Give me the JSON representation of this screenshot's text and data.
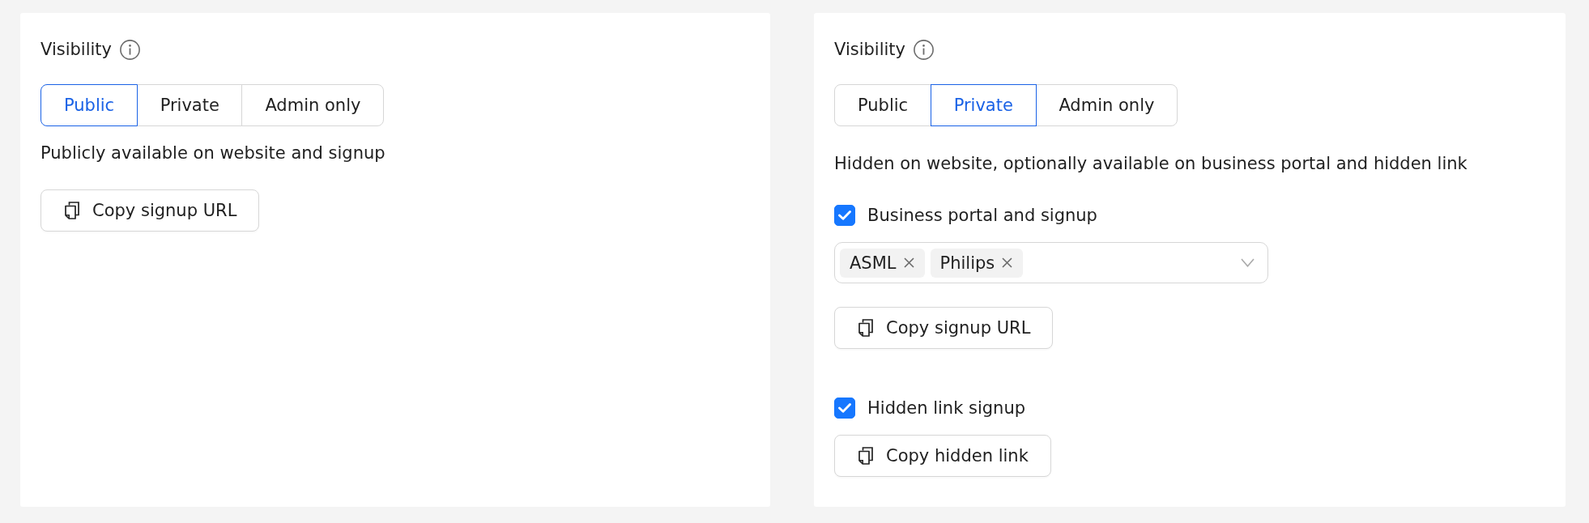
{
  "panels": [
    {
      "visibility": {
        "label": "Visibility",
        "options": [
          {
            "label": "Public",
            "selected": true
          },
          {
            "label": "Private",
            "selected": false
          },
          {
            "label": "Admin only",
            "selected": false
          }
        ]
      },
      "description": "Publicly available on website and signup",
      "sections": [
        {
          "kind": "button",
          "label": "Copy signup URL"
        }
      ]
    },
    {
      "visibility": {
        "label": "Visibility",
        "options": [
          {
            "label": "Public",
            "selected": false
          },
          {
            "label": "Private",
            "selected": true
          },
          {
            "label": "Admin only",
            "selected": false
          }
        ]
      },
      "description": "Hidden on website, optionally available on business portal and hidden link",
      "sections": [
        {
          "kind": "checkbox",
          "label": "Business portal and signup",
          "checked": true
        },
        {
          "kind": "tag_select",
          "tags": [
            "ASML",
            "Philips"
          ]
        },
        {
          "kind": "button",
          "label": "Copy signup URL"
        },
        {
          "kind": "checkbox",
          "label": "Hidden link signup",
          "checked": true
        },
        {
          "kind": "button",
          "label": "Copy hidden link"
        }
      ]
    }
  ]
}
